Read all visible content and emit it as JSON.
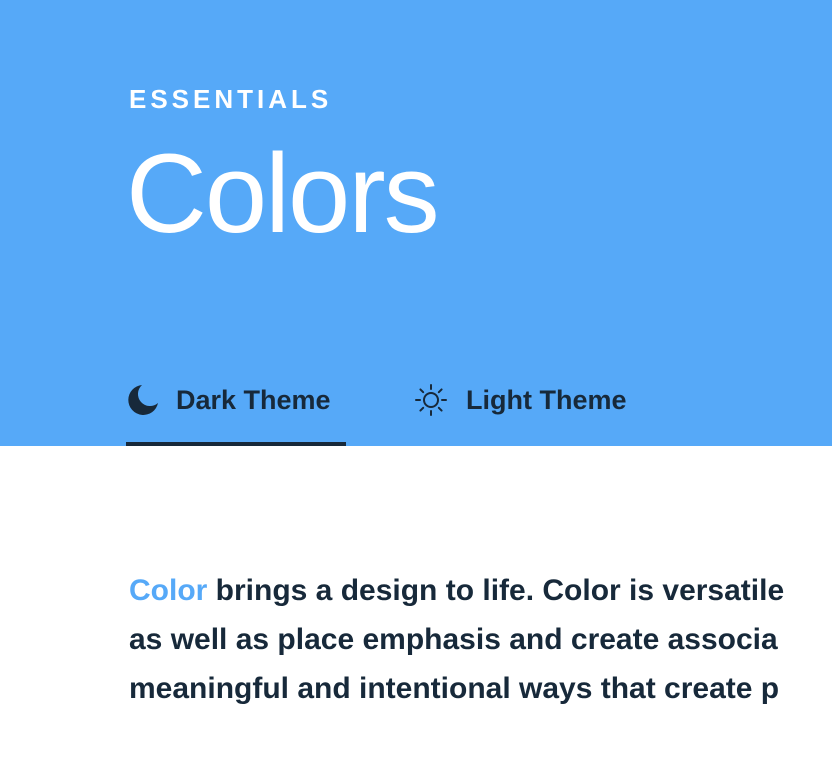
{
  "header": {
    "eyebrow": "ESSENTIALS",
    "title": "Colors",
    "background_color": "#56a9f8"
  },
  "tabs": [
    {
      "label": "Dark Theme",
      "icon": "moon-icon",
      "selected": true
    },
    {
      "label": "Light Theme",
      "icon": "sun-icon",
      "selected": false
    }
  ],
  "intro": {
    "highlight": "Color",
    "line1_rest": " brings a design to life. Color is versatile",
    "line2": "as well as place emphasis and create associa",
    "line3": "meaningful and intentional ways that create p",
    "accent_color": "#56a9f8",
    "text_color": "#17293a"
  }
}
